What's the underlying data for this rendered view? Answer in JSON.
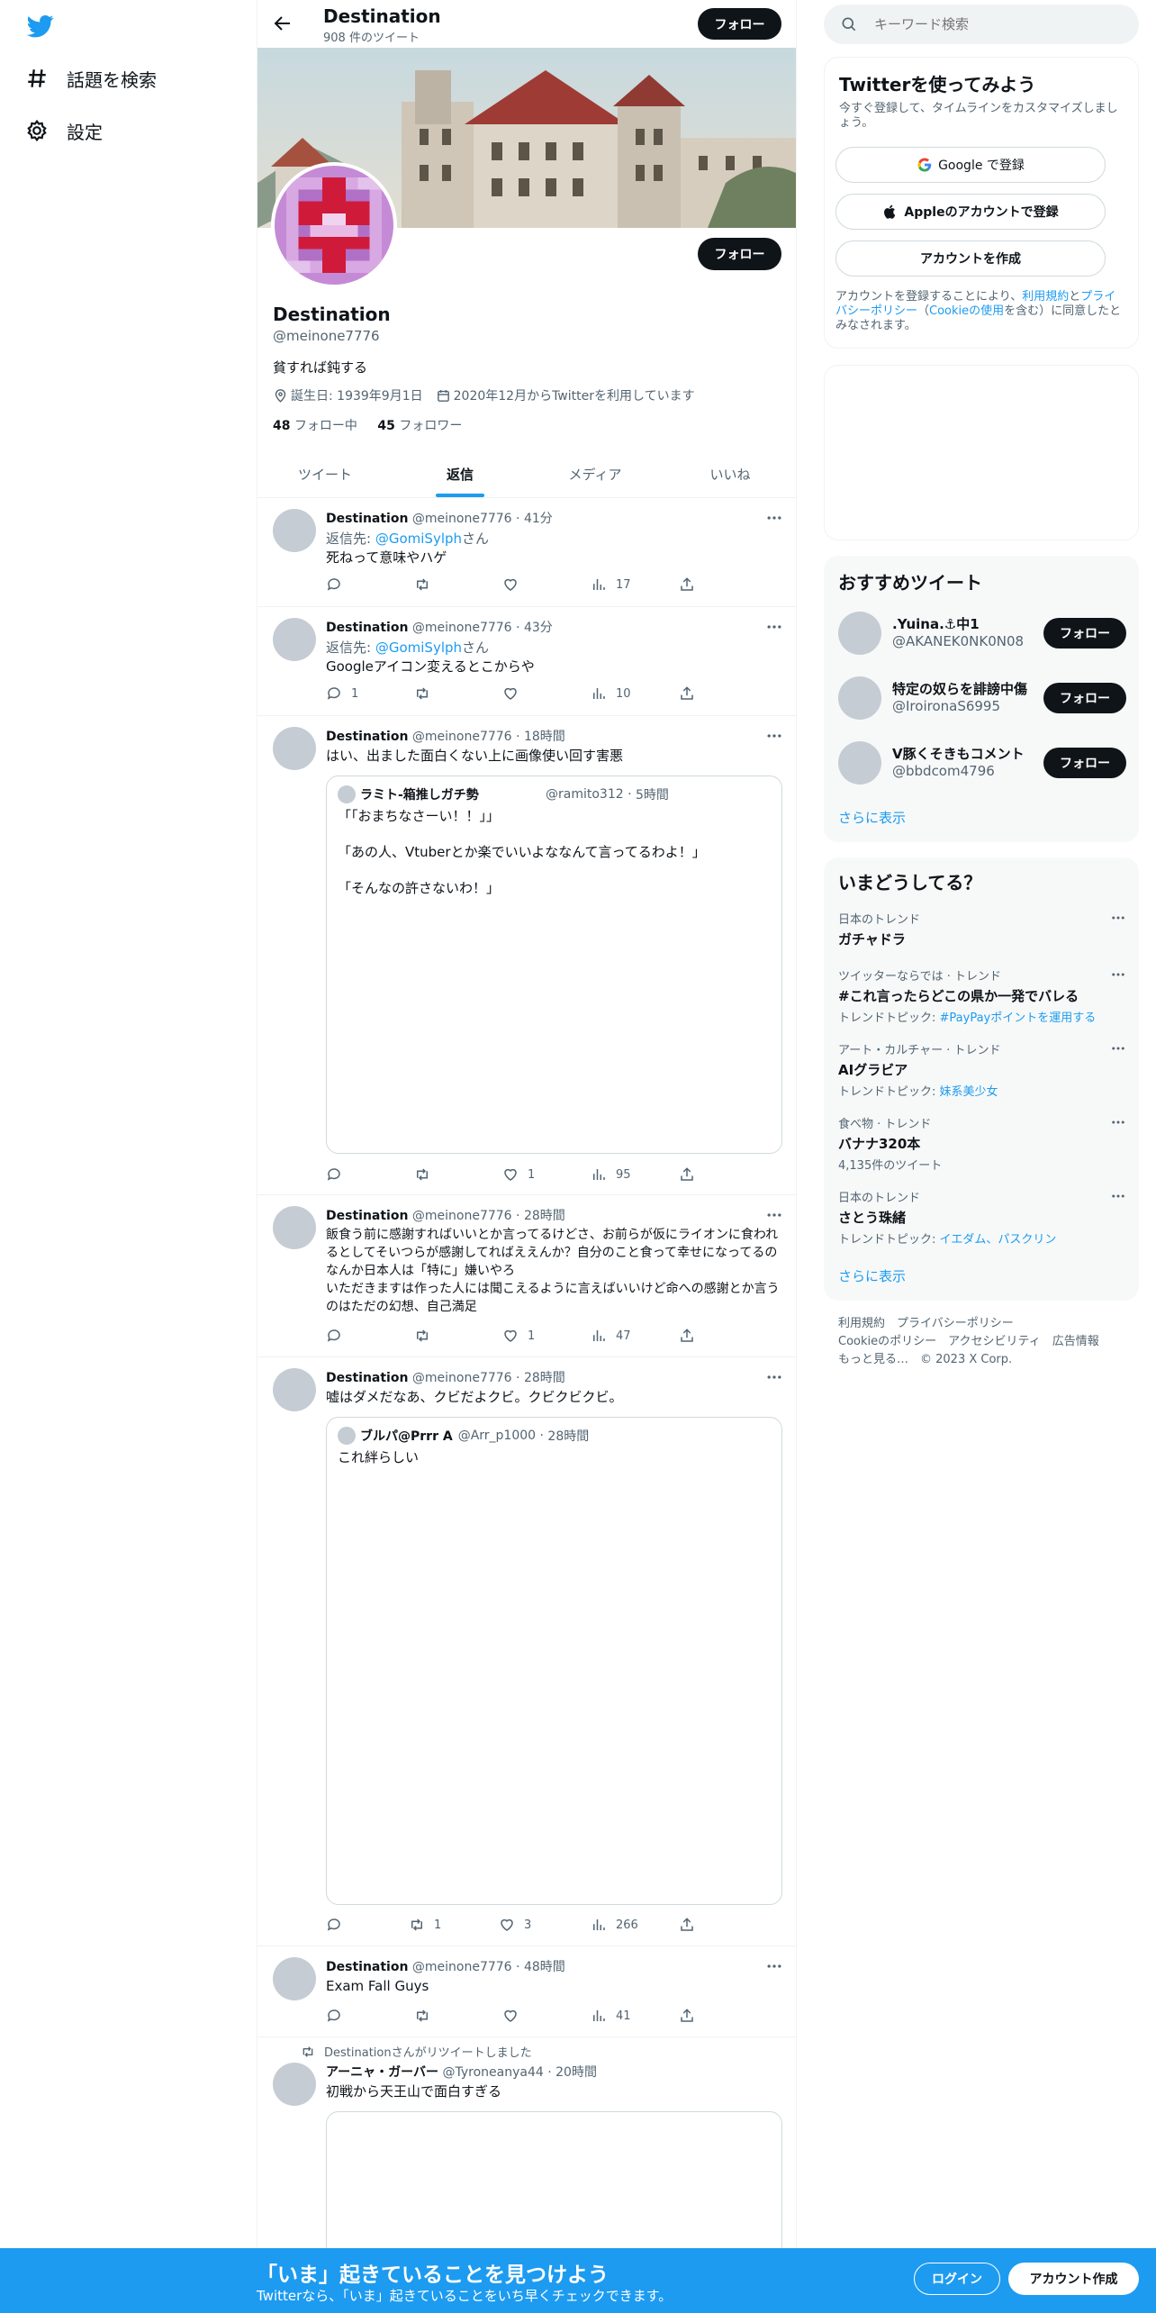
{
  "nav": {
    "explore_label": "話題を検索",
    "settings_label": "設定"
  },
  "header": {
    "name": "Destination",
    "tweet_count": "908 件のツイート",
    "follow_label": "フォロー"
  },
  "profile": {
    "name": "Destination",
    "handle": "@meinone7776",
    "bio": "貧すれば鈍する",
    "birthday": "誕生日: 1939年9月1日",
    "joined": "2020年12月からTwitterを利用しています",
    "following_count": "48",
    "following_label": "フォロー中",
    "followers_count": "45",
    "followers_label": "フォロワー",
    "follow_label": "フォロー"
  },
  "tabs": [
    {
      "label": "ツイート"
    },
    {
      "label": "返信"
    },
    {
      "label": "メディア"
    },
    {
      "label": "いいね"
    }
  ],
  "tweets": [
    {
      "name": "Destination",
      "handle": "@meinone7776",
      "time": "41分",
      "reply_prefix": "返信先:",
      "reply_to": "@GomiSylph",
      "reply_suffix": "さん",
      "text": "死ねって意味やハゲ",
      "replies": "",
      "retweets": "",
      "likes": "",
      "views": "17"
    },
    {
      "name": "Destination",
      "handle": "@meinone7776",
      "time": "43分",
      "reply_prefix": "返信先:",
      "reply_to": "@GomiSylph",
      "reply_suffix": "さん",
      "text": "Googleアイコン変えるとこからや",
      "replies": "1",
      "retweets": "",
      "likes": "",
      "views": "10"
    },
    {
      "name": "Destination",
      "handle": "@meinone7776",
      "time": "18時間",
      "text": "はい、出ました面白くない上に画像使い回す害悪",
      "quote": {
        "name": "ラミト-箱推しガチ勢",
        "handle": "@ramito312",
        "time": "5時間",
        "text": "「「おまちなさーい！！」」\n\n「あの人、Vtuberとか楽でいいよななんて言ってるわよ！」\n\n「そんなの許さないわ！」"
      },
      "replies": "",
      "retweets": "",
      "likes": "1",
      "views": "95"
    },
    {
      "name": "Destination",
      "handle": "@meinone7776",
      "time": "28時間",
      "text": "飯食う前に感謝すればいいとか言ってるけどさ、お前らが仮にライオンに食われるとしてそいつらが感謝してればええんか？自分のこと食って幸せになってるのなんか日本人は「特に」嫌いやろ\nいただきますは作った人には聞こえるように言えばいいけど命への感謝とか言うのはただの幻想、自己満足",
      "replies": "",
      "retweets": "",
      "likes": "1",
      "views": "47"
    },
    {
      "name": "Destination",
      "handle": "@meinone7776",
      "time": "28時間",
      "text": "嘘はダメだなあ、クビだよクビ。クビクビクビ。",
      "quote": {
        "name": "ブルパ@Prrr A",
        "handle": "@Arr_p1000",
        "time": "28時間",
        "text": "これ絆らしい"
      },
      "replies": "",
      "retweets": "1",
      "likes": "3",
      "views": "266"
    },
    {
      "name": "Destination",
      "handle": "@meinone7776",
      "time": "48時間",
      "text": "Exam Fall Guys",
      "replies": "",
      "retweets": "",
      "likes": "",
      "views": "41"
    },
    {
      "retweeted_by": "Destinationさんがリツイートしました",
      "name": "アーニャ・ガーバー",
      "handle": "@Tyroneanya44",
      "time": "20時間",
      "text": "初戦から天王山で面白すぎる"
    }
  ],
  "search": {
    "placeholder": "キーワード検索"
  },
  "signup_card": {
    "title": "Twitterを使ってみよう",
    "subtitle": "今すぐ登録して、タイムラインをカスタマイズしましょう。",
    "google_label": "Google で登録",
    "apple_label": "Appleのアカウントで登録",
    "create_label": "アカウントを作成",
    "legal_prefix": "アカウントを登録することにより、",
    "legal_terms": "利用規約",
    "legal_and": "と",
    "legal_privacy": "プライバシーポリシー",
    "legal_mid": "（",
    "legal_cookie": "Cookieの使用",
    "legal_suffix": "を含む）に同意したとみなされます。"
  },
  "recommend": {
    "title": "おすすめツイート",
    "users": [
      {
        "name": ".Yuina.⚓中1",
        "handle": "@AKANEK0NK0N08"
      },
      {
        "name": "特定の奴らを誹謗中傷",
        "handle": "@IroironaS6995"
      },
      {
        "name": "V豚くそきもコメント",
        "handle": "@bbdcom4796"
      }
    ],
    "follow_label": "フォロー",
    "show_more": "さらに表示"
  },
  "trends": {
    "title": "いまどうしてる？",
    "items": [
      {
        "category": "日本のトレンド",
        "name": "ガチャドラ",
        "sub_prefix": "",
        "sub_link": ""
      },
      {
        "category": "ツイッターならでは · トレンド",
        "name": "#これ言ったらどこの県か一発でバレる",
        "sub_prefix": "トレンドトピック: ",
        "sub_link": "#PayPayポイントを運用する"
      },
      {
        "category": "アート・カルチャー · トレンド",
        "name": "AIグラビア",
        "sub_prefix": "トレンドトピック: ",
        "sub_link": "妹系美少女"
      },
      {
        "category": "食べ物 · トレンド",
        "name": "バナナ320本",
        "sub_prefix": "4,135件のツイート",
        "sub_link": ""
      },
      {
        "category": "日本のトレンド",
        "name": "さとう珠緒",
        "sub_prefix": "トレンドトピック: ",
        "sub_link": "イエダム、パスクリン"
      }
    ],
    "show_more": "さらに表示"
  },
  "footer": {
    "line1": "利用規約　プライバシーポリシー",
    "line2": "Cookieのポリシー　アクセシビリティ　広告情報",
    "line3": "もっと見る…　© 2023 X Corp."
  },
  "bottom": {
    "title": "「いま」起きていることを見つけよう",
    "subtitle": "Twitterなら、「いま」起きていることをいち早くチェックできます。",
    "login_label": "ログイン",
    "signup_label": "アカウント作成"
  },
  "colors": {
    "accent": "#1d9bf0",
    "dark": "#0f1419",
    "muted": "#536471"
  }
}
